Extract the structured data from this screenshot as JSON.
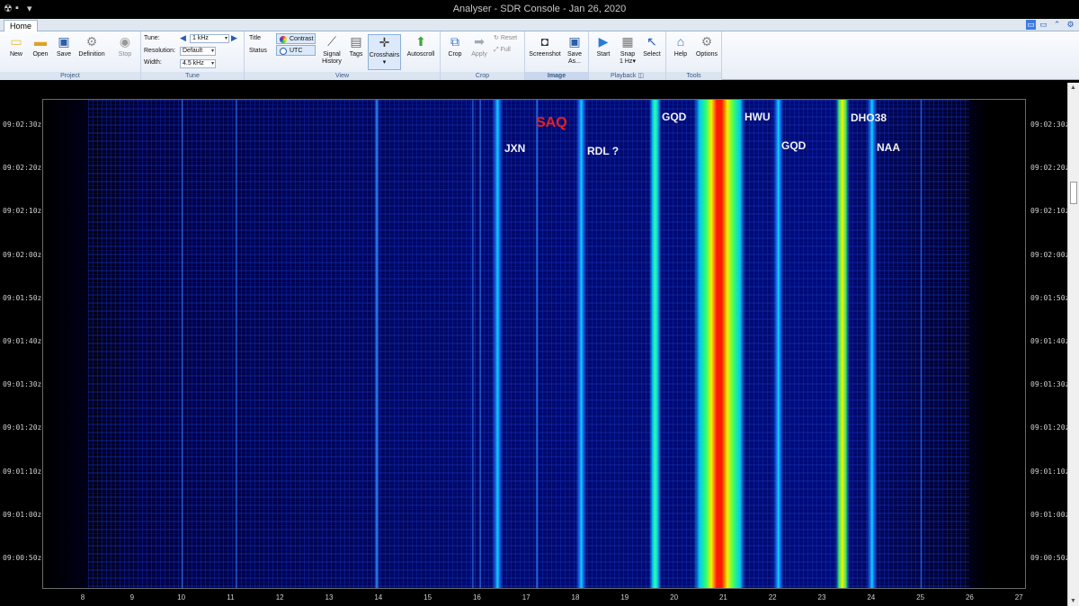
{
  "window": {
    "title": "Analyser - SDR Console - Jan 26, 2020"
  },
  "tabs": {
    "home": "Home"
  },
  "ribbon": {
    "project": {
      "label": "Project",
      "new": "New",
      "open": "Open",
      "save": "Save",
      "definition": "Definition",
      "stop": "Stop"
    },
    "tune": {
      "label": "Tune",
      "tune_label": "Tune:",
      "tune_value": "1 kHz",
      "resolution_label": "Resolution:",
      "resolution_value": "Default",
      "width_label": "Width:",
      "width_value": "4.5 kHz"
    },
    "view": {
      "label": "View",
      "title": "Title",
      "status": "Status",
      "contrast": "Contrast",
      "utc": "UTC",
      "signal": "Signal",
      "history": "History",
      "tags": "Tags",
      "crosshairs": "Crosshairs",
      "autoscroll": "Autoscroll"
    },
    "crop": {
      "label": "Crop",
      "crop": "Crop",
      "apply": "Apply",
      "reset": "Reset",
      "full": "Full"
    },
    "image": {
      "label": "Image",
      "screenshot": "Screenshot",
      "save": "Save",
      "as": "As..."
    },
    "playback": {
      "label": "Playback",
      "start": "Start",
      "snap": "Snap",
      "snap_value": "1 Hz",
      "select": "Select"
    },
    "tools": {
      "label": "Tools",
      "help": "Help",
      "options": "Options"
    }
  },
  "spectrogram": {
    "x_ticks": [
      "8",
      "9",
      "10",
      "11",
      "12",
      "13",
      "14",
      "15",
      "16",
      "17",
      "18",
      "19",
      "20",
      "21",
      "22",
      "23",
      "24",
      "25",
      "26",
      "27"
    ],
    "y_ticks": [
      "09:02:30z",
      "09:02:20z",
      "09:02:10z",
      "09:02:00z",
      "09:01:50z",
      "09:01:40z",
      "09:01:30z",
      "09:01:20z",
      "09:01:10z",
      "09:01:00z",
      "09:00:50z"
    ],
    "stations": [
      {
        "name": "JXN",
        "freq_khz": 16.4,
        "color": "#f2f2f2"
      },
      {
        "name": "SAQ",
        "freq_khz": 17.2,
        "color": "#e8201c"
      },
      {
        "name": "RDL ?",
        "freq_khz": 18.1,
        "color": "#f2f2f2"
      },
      {
        "name": "GQD",
        "freq_khz": 19.6,
        "color": "#f2f2f2"
      },
      {
        "name": "HWU",
        "freq_khz": 20.9,
        "color": "#f2f2f2"
      },
      {
        "name": "GQD",
        "freq_khz": 22.1,
        "color": "#f2f2f2"
      },
      {
        "name": "DHO38",
        "freq_khz": 23.4,
        "color": "#f2f2f2"
      },
      {
        "name": "NAA",
        "freq_khz": 24.0,
        "color": "#f2f2f2"
      }
    ],
    "colors": {
      "background": "#00004a",
      "weak": "#0a2aa8",
      "mid": "#1e6fff",
      "strong": "#00e0ff",
      "peak": "#ff1a00"
    }
  }
}
